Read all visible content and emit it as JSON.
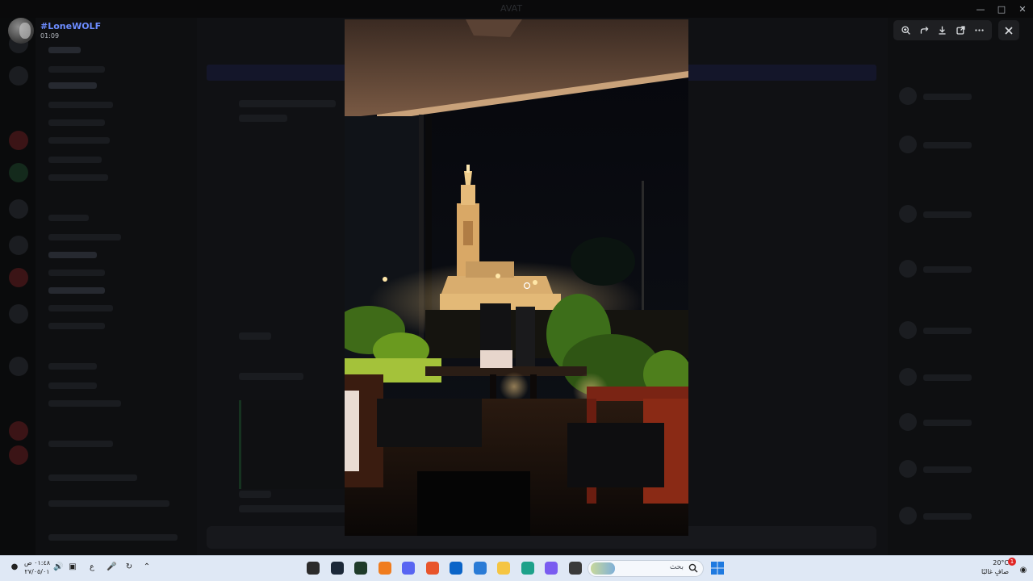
{
  "app": {
    "window_title": "AVAT"
  },
  "viewer": {
    "username": "#LoneWOLF",
    "timestamp": "01:09",
    "toolbar": {
      "zoom_icon": "zoom-in-icon",
      "forward_icon": "forward-icon",
      "download_icon": "download-icon",
      "open_icon": "open-external-icon",
      "more_icon": "more-icon"
    },
    "close_icon": "close-icon"
  },
  "photo": {
    "description_icon": "night-mosque-terrace-photo"
  },
  "taskbar": {
    "clock_time": "٠١:٤٨ ص",
    "clock_date": "٢٧/٠٥/٠١",
    "language": "ع",
    "search_placeholder": "بحث",
    "weather_temp": "20°C",
    "weather_desc": "صافٍ غالبًا",
    "notification_count": "1",
    "pinned_apps": [
      {
        "name": "record-app-icon",
        "color": "#2b2b2b"
      },
      {
        "name": "steam-icon",
        "color": "#1b2838"
      },
      {
        "name": "terminal-icon",
        "color": "#1f3b2a"
      },
      {
        "name": "avast-icon",
        "color": "#f07c1e"
      },
      {
        "name": "discord-icon",
        "color": "#5865f2"
      },
      {
        "name": "brave-icon",
        "color": "#e8542b"
      },
      {
        "name": "outlook-icon",
        "color": "#0a64c8"
      },
      {
        "name": "store-icon",
        "color": "#2a7bd6"
      },
      {
        "name": "file-explorer-icon",
        "color": "#f5c542"
      },
      {
        "name": "edge-icon",
        "color": "#1da18a"
      },
      {
        "name": "copilot-icon",
        "color": "#7a5cf0"
      },
      {
        "name": "app-window-icon",
        "color": "#3a3a3a"
      }
    ]
  }
}
